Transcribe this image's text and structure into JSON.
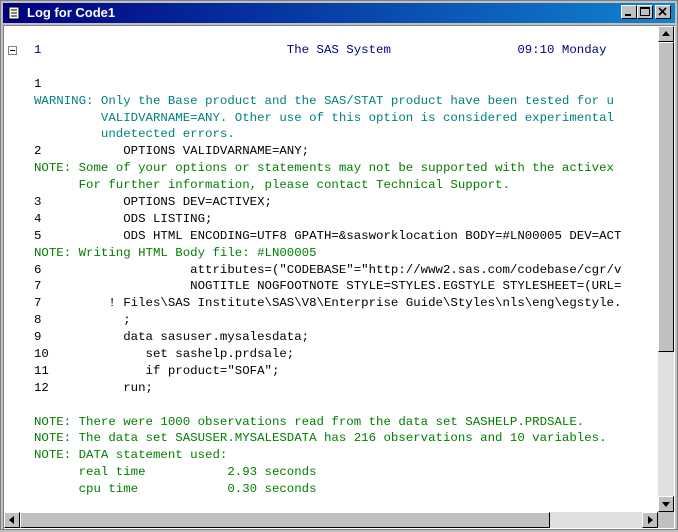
{
  "window": {
    "title": "Log for Code1",
    "minimize_icon": "minimize-icon",
    "maximize_icon": "maximize-icon",
    "close_icon": "close-icon"
  },
  "log": {
    "lines": [
      {
        "type": "header",
        "text": "1                                 The SAS System                 09:10 Monday"
      },
      {
        "type": "code",
        "text": ""
      },
      {
        "type": "code",
        "text": "1"
      },
      {
        "type": "warn",
        "text": "WARNING: Only the Base product and the SAS/STAT product have been tested for u"
      },
      {
        "type": "warn",
        "text": "         VALIDVARNAME=ANY. Other use of this option is considered experimental"
      },
      {
        "type": "warn",
        "text": "         undetected errors."
      },
      {
        "type": "code",
        "text": "2           OPTIONS VALIDVARNAME=ANY;"
      },
      {
        "type": "note",
        "text": "NOTE: Some of your options or statements may not be supported with the activex"
      },
      {
        "type": "note",
        "text": "      For further information, please contact Technical Support."
      },
      {
        "type": "code",
        "text": "3           OPTIONS DEV=ACTIVEX;"
      },
      {
        "type": "code",
        "text": "4           ODS LISTING;"
      },
      {
        "type": "code",
        "text": "5           ODS HTML ENCODING=UTF8 GPATH=&sasworklocation BODY=#LN00005 DEV=ACT"
      },
      {
        "type": "note",
        "text": "NOTE: Writing HTML Body file: #LN00005"
      },
      {
        "type": "code",
        "text": "6                    attributes=(\"CODEBASE\"=\"http://www2.sas.com/codebase/cgr/v"
      },
      {
        "type": "code",
        "text": "7                    NOGTITLE NOGFOOTNOTE STYLE=STYLES.EGSTYLE STYLESHEET=(URL="
      },
      {
        "type": "code",
        "text": "7         ! Files\\SAS Institute\\SAS\\V8\\Enterprise Guide\\Styles\\nls\\eng\\egstyle."
      },
      {
        "type": "code",
        "text": "8           ;"
      },
      {
        "type": "code",
        "text": "9           data sasuser.mysalesdata;"
      },
      {
        "type": "code",
        "text": "10             set sashelp.prdsale;"
      },
      {
        "type": "code",
        "text": "11             if product=\"SOFA\";"
      },
      {
        "type": "code",
        "text": "12          run;"
      },
      {
        "type": "code",
        "text": ""
      },
      {
        "type": "note",
        "text": "NOTE: There were 1000 observations read from the data set SASHELP.PRDSALE."
      },
      {
        "type": "note",
        "text": "NOTE: The data set SASUSER.MYSALESDATA has 216 observations and 10 variables."
      },
      {
        "type": "note",
        "text": "NOTE: DATA statement used:"
      },
      {
        "type": "note",
        "text": "      real time           2.93 seconds"
      },
      {
        "type": "note",
        "text": "      cpu time            0.30 seconds"
      }
    ]
  }
}
